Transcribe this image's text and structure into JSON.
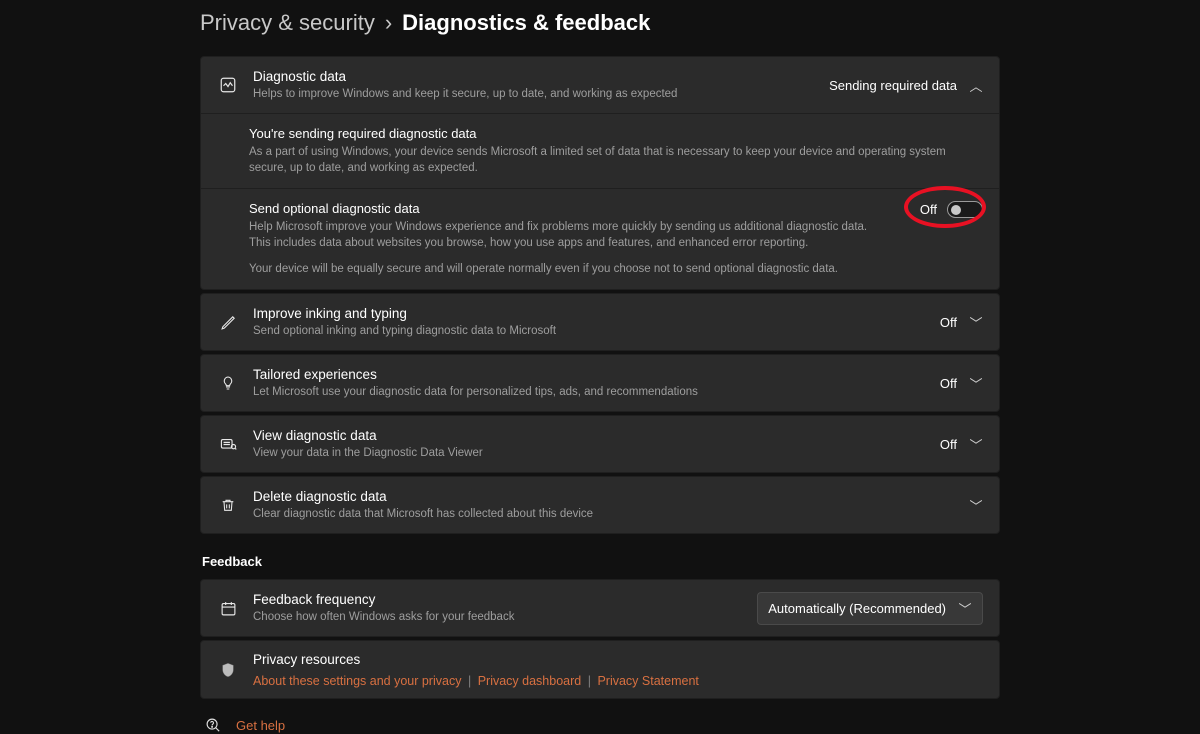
{
  "breadcrumb": {
    "parent": "Privacy & security",
    "sep": "›",
    "current": "Diagnostics & feedback"
  },
  "diagnostic": {
    "title": "Diagnostic data",
    "desc": "Helps to improve Windows and keep it secure, up to date, and working as expected",
    "status": "Sending required data",
    "required": {
      "title": "You're sending required diagnostic data",
      "desc": "As a part of using Windows, your device sends Microsoft a limited set of data that is necessary to keep your device and operating system secure, up to date, and working as expected."
    },
    "optional": {
      "title": "Send optional diagnostic data",
      "desc": "Help Microsoft improve your Windows experience and fix problems more quickly by sending us additional diagnostic data. This includes data about websites you browse, how you use apps and features, and enhanced error reporting.",
      "note": "Your device will be equally secure and will operate normally even if you choose not to send optional diagnostic data.",
      "toggle_label": "Off"
    }
  },
  "rows": {
    "inking": {
      "title": "Improve inking and typing",
      "desc": "Send optional inking and typing diagnostic data to Microsoft",
      "value": "Off"
    },
    "tailored": {
      "title": "Tailored experiences",
      "desc": "Let Microsoft use your diagnostic data for personalized tips, ads, and recommendations",
      "value": "Off"
    },
    "view": {
      "title": "View diagnostic data",
      "desc": "View your data in the Diagnostic Data Viewer",
      "value": "Off"
    },
    "delete": {
      "title": "Delete diagnostic data",
      "desc": "Clear diagnostic data that Microsoft has collected about this device"
    }
  },
  "feedback": {
    "section_label": "Feedback",
    "frequency": {
      "title": "Feedback frequency",
      "desc": "Choose how often Windows asks for your feedback",
      "selected": "Automatically (Recommended)"
    },
    "resources": {
      "title": "Privacy resources",
      "links": {
        "a": "About these settings and your privacy",
        "b": "Privacy dashboard",
        "c": "Privacy Statement"
      }
    }
  },
  "help": {
    "label": "Get help"
  }
}
